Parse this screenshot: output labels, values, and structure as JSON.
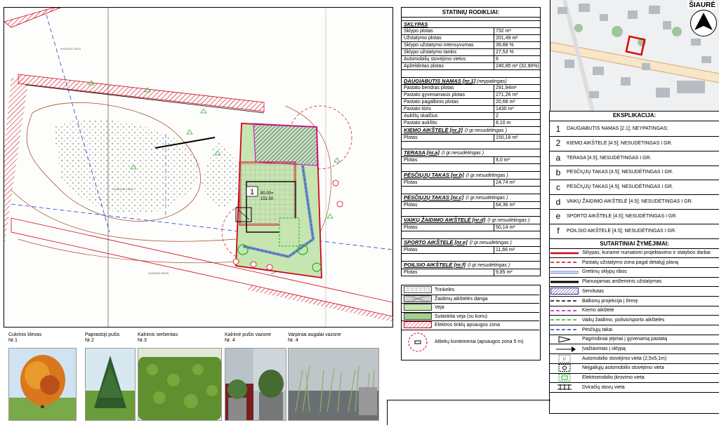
{
  "stats": {
    "title": "STATINIŲ RODIKLIAI:",
    "sklypas_header": "SKLYPAS",
    "sklypas_rows": [
      {
        "label": "Sklypo plotas",
        "value": "732 m²"
      },
      {
        "label": "Užstatymo plotas",
        "value": "201,49 m²"
      },
      {
        "label": "Sklypo užstatymo intensyvumas",
        "value": "39,88 %"
      },
      {
        "label": "Sklypo užstatymo tankis",
        "value": "27,53 %"
      },
      {
        "label": "Automobilių stovėjimo vietos",
        "value": "6"
      },
      {
        "label": "Apželdintas plotas",
        "value": "240,85 m² (32,90%)"
      }
    ],
    "namas_header": "DAUGIABUTIS NAMAS [nr.1]",
    "namas_sub": "(neypatingas)",
    "namas_rows": [
      {
        "label": "Pastato bendras plotas",
        "value": "291,94m²"
      },
      {
        "label": "Pastato gyvenamasis plotas",
        "value": "271,26 m²"
      },
      {
        "label": "Pastato pagalbinis plotas",
        "value": "20,68 m²"
      },
      {
        "label": "Pastato tūris",
        "value": "1430 m³"
      },
      {
        "label": "Aukštų skaičius",
        "value": "2"
      },
      {
        "label": "Pastato aukštis",
        "value": "8,10 m"
      }
    ],
    "sections": [
      {
        "header": "KIEMO AIKŠTELĖ [nr.2]",
        "sub": "(I gr.nesudėtingas )",
        "label": "Plotas",
        "value": "150,18 m²"
      },
      {
        "header": "TERASA [nr.a]",
        "sub": "(I gr.nesudėtingas )",
        "label": "Plotas",
        "value": "8,0 m²"
      },
      {
        "header": "PĖSČIŲJŲ TAKAS [nr.b]",
        "sub": "(I gr.nesudėtingas )",
        "label": "Plotas",
        "value": "24,74 m²"
      },
      {
        "header": "PĖSČIŲJŲ TAKAS [nr.c]",
        "sub": "(I gr.nesudėtingas )",
        "label": "Plotas",
        "value": "64,36 m²"
      },
      {
        "header": "VAIKŲ ŽAIDIMO AIKŠTELĖ [nr.d]",
        "sub": "(I gr.nesudėtingas )",
        "label": "Plotas",
        "value": "50,14 m²"
      },
      {
        "header": "SPORTO AIKŠTELĖ [nr.e]",
        "sub": "(I gr.nesudėtingas )",
        "label": "Plotas",
        "value": "11,66 m²"
      },
      {
        "header": "POILSIO AIKŠTELĖ [nr.f]",
        "sub": "(I gr.nesudėtingas )",
        "label": "Plotas",
        "value": "9,85 m²"
      }
    ]
  },
  "materials_legend": [
    {
      "label": "Trinkelės",
      "icon": "paving-pattern"
    },
    {
      "label": "Žaidimų aikštelės danga",
      "icon": "playground-cover"
    },
    {
      "label": "Veja",
      "icon": "lawn"
    },
    {
      "label": "Sutankita veja (su koriu)",
      "icon": "reinforced-lawn"
    },
    {
      "label": "Elektros tinklų apsaugos zona",
      "icon": "power-zone"
    },
    {
      "label": "Atliekų konteineriai (apsaugos zona 5 m)",
      "icon": "waste-container"
    }
  ],
  "plants": [
    {
      "name": "Cukrinis klevas",
      "nr": "Nr.1"
    },
    {
      "name": "Paprastoji pušis",
      "nr": "Nr.2"
    },
    {
      "name": "Kalninis serbentas",
      "nr": "Nr.3"
    },
    {
      "name": "Kalninė pušis vazone",
      "nr": "Nr. 4"
    },
    {
      "name": "Varpiniai augalai vazone",
      "nr": "Nr. 4"
    }
  ],
  "map": {
    "north_label": "ŠIAURĖ"
  },
  "explication": {
    "title": "EKSPLIKACIJA:",
    "items": [
      {
        "num": "1",
        "text": "DAUGIABUTIS NAMAS [2.1]; NEYPATINGAS;"
      },
      {
        "num": "2",
        "text": "KIEMO AIKŠTELĖ [4.5]; NESUDĖTINGAS I GR."
      },
      {
        "num": "a",
        "text": "TERASA [4.5]; NESUDĖTINGAS I GR."
      },
      {
        "num": "b",
        "text": "PĖSČIŲJŲ TAKAS [4.5]; NESUDĖTINGAS I GR."
      },
      {
        "num": "c",
        "text": "PĖSČIŲJŲ TAKAS [4.5]; NESUDĖTINGAS I GR."
      },
      {
        "num": "d",
        "text": "VAIKŲ ŽAIDIMO AIKŠTELĖ [4.5]; NESUDĖTINGAS I GR."
      },
      {
        "num": "e",
        "text": "SPORTO AIKŠTELĖ [4.5]; NESUDĖTINGAS I GR."
      },
      {
        "num": "f",
        "text": "POILSIO AIKŠTELĖ [4.5]; NESUDĖTINGAS I GR."
      }
    ]
  },
  "symbols": {
    "title": "SUTARTINIAI ŽYMĖJIMAI:",
    "items": [
      {
        "text": "Sklypas, kuriame numatomi projektavimo ir statybos darbai",
        "icon": "red-solid-line"
      },
      {
        "text": "Pastatų užstatymo zona pagal detalųjį planą",
        "icon": "red-dashed-line"
      },
      {
        "text": "Gretimų sklypų ribos",
        "icon": "blue-double-line"
      },
      {
        "text": "Planuojamas antžeminis užstatymas",
        "icon": "black-thick-line"
      },
      {
        "text": "Servitutas",
        "icon": "hatch-box"
      },
      {
        "text": "Balkonų projekcija į žemę",
        "icon": "black-dashed-line"
      },
      {
        "text": "Kiemo aikštelė",
        "icon": "magenta-dashed-line"
      },
      {
        "text": "Vaikų žaidimo, poilsio/sporto aikštelės",
        "icon": "green-dashed-line"
      },
      {
        "text": "Pėsčiųjų takai",
        "icon": "blue-dashed-line"
      },
      {
        "text": "Pagrindiniai įėjimai į gyvenamą pastatą",
        "icon": "entry-arrow"
      },
      {
        "text": "Įvažiavimas į sklypą",
        "icon": "drive-arrow"
      },
      {
        "text": "Automobilio stovėjimo vieta (2,5x5,1m)",
        "icon": "parking-p"
      },
      {
        "text": "Neįgaliųjų automobilio stovėjimo vieta",
        "icon": "disabled-parking"
      },
      {
        "text": "Elektromobilio įkrovimo vieta",
        "icon": "ev-charging"
      },
      {
        "text": "Dviračių stovų vieta",
        "icon": "bike-rack"
      }
    ]
  },
  "plan": {
    "building_label": "1",
    "building_level_1": "80.00=",
    "building_level_2": "151.50"
  },
  "colors": {
    "border_red": "#d0021b",
    "servitude": "#4a3fa0",
    "lawn": "#c6e5b0",
    "magenta": "#d000d0",
    "blue": "#1f3fd0",
    "green": "#22b022"
  }
}
